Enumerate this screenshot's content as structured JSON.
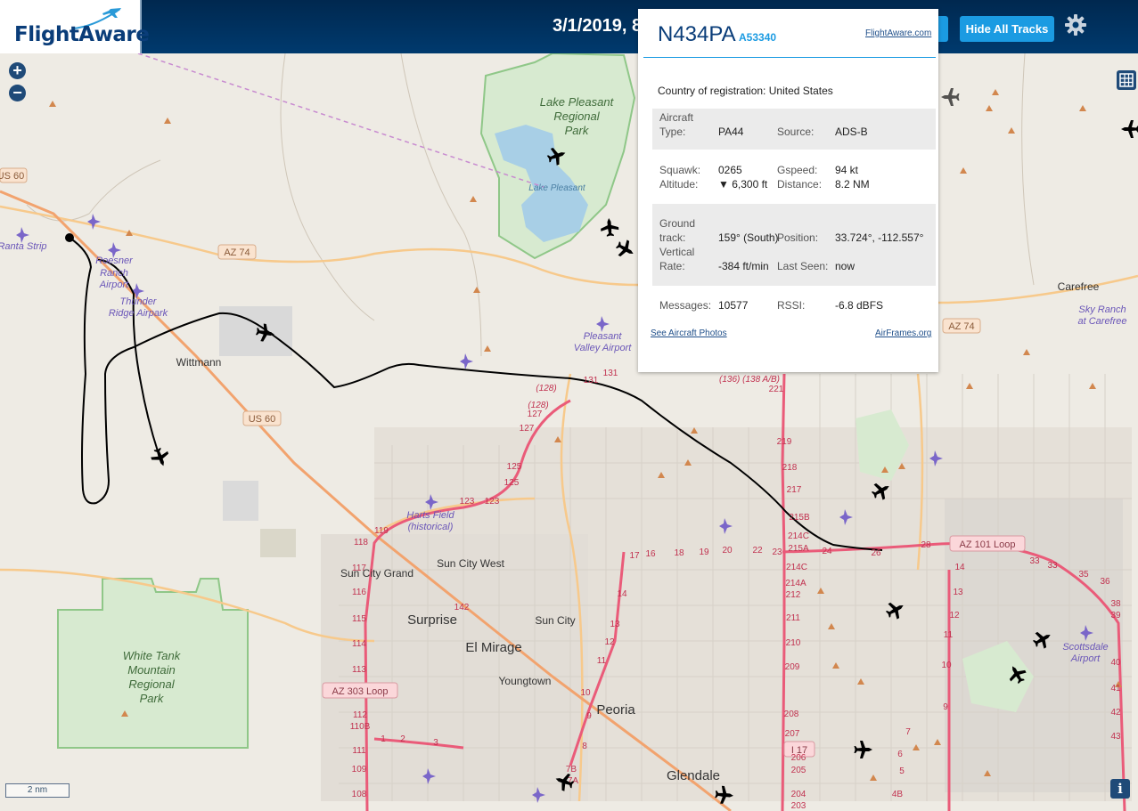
{
  "header": {
    "logo": "FlightAware",
    "datetime": "3/1/2019, 8",
    "hide_tracks_label": "Hide All Tracks",
    "settings_icon": "gear-icon",
    "accent": "#1b9be2",
    "bar_color": "#00284f"
  },
  "controls": {
    "zoom_in_icon": "plus-icon",
    "zoom_out_icon": "minus-icon",
    "layers_icon": "grid-icon",
    "scale_label": "2 nm",
    "info_icon": "info-icon"
  },
  "popup": {
    "ident": "N434PA",
    "hex": "A53340",
    "site_link": "FlightAware.com",
    "country_label": "Country of registration:",
    "country_value": "United States",
    "aircraft_type_label1": "Aircraft",
    "aircraft_type_label2": "Type:",
    "aircraft_type": "PA44",
    "source_label": "Source:",
    "source": "ADS-B",
    "squawk_label": "Squawk:",
    "squawk": "0265",
    "altitude_label": "Altitude:",
    "altitude": "▼ 6,300 ft",
    "gspeed_label": "Gspeed:",
    "gspeed": "94 kt",
    "distance_label": "Distance:",
    "distance": "8.2 NM",
    "ground_track_label1": "Ground",
    "ground_track_label2": "track:",
    "ground_track": "159° (South)",
    "position_label": "Position:",
    "position": "33.724°, -112.557°",
    "vrate_label1": "Vertical",
    "vrate_label2": "Rate:",
    "vrate": "-384 ft/min",
    "last_seen_label": "Last Seen:",
    "last_seen": "now",
    "messages_label": "Messages:",
    "messages": "10577",
    "rssi_label": "RSSI:",
    "rssi": "-6.8 dBFS",
    "photos_link": "See Aircraft Photos",
    "airframes_link": "AirFrames.org"
  },
  "map": {
    "labels": {
      "lake_park_1": "Lake Pleasant",
      "lake_park_2": "Regional",
      "lake_park_3": "Park",
      "lake": "Lake Pleasant",
      "us60_top": "US 60",
      "az74_left": "AZ 74",
      "az74_right": "AZ 74",
      "us60_mid": "US 60",
      "ranta": "Ranta Strip",
      "roesner_1": "Roesner",
      "roesner_2": "Ranch",
      "roesner_3": "Airport",
      "thunder_1": "Thunder",
      "thunder_2": "Ridge Airpark",
      "wittmann": "Wittmann",
      "pleasant_valley_1": "Pleasant",
      "pleasant_valley_2": "Valley Airport",
      "carefree": "Carefree",
      "sky_ranch_1": "Sky Ranch",
      "sky_ranch_2": "at Carefree",
      "harts_1": "Harts Field",
      "harts_2": "(historical)",
      "sun_city_grand": "Sun City Grand",
      "sun_city_west": "Sun City West",
      "surprise": "Surprise",
      "sun_city": "Sun City",
      "el_mirage": "El Mirage",
      "youngtown": "Youngtown",
      "peoria": "Peoria",
      "glendale": "Glendale",
      "white_tank_1": "White Tank",
      "white_tank_2": "Mountain",
      "white_tank_3": "Regional",
      "white_tank_4": "Park",
      "az101": "AZ 101 Loop",
      "az303": "AZ 303 Loop",
      "i17": "I 17",
      "scottsdale_1": "Scottsdale",
      "scottsdale_2": "Airport",
      "exits_138": "(136)  (138 A/B)",
      "r221": "221",
      "r219": "219",
      "r218": "218",
      "r217": "217",
      "r215b": "215B",
      "r214c": "214C",
      "r215a": "215A",
      "r214c2": "214C",
      "r214a": "214A",
      "r212": "212",
      "r211": "211",
      "r210": "210",
      "r209": "209",
      "r208": "208",
      "r207": "207",
      "r206": "206",
      "r205": "205",
      "r204": "204",
      "r203": "203",
      "r131a": "131",
      "r131b": "131",
      "r128a": "(128)",
      "r128b": "(128)",
      "r127a": "127",
      "r127b": "127",
      "r125a": "125",
      "r125b": "125",
      "r123a": "123",
      "r123b": "123",
      "r119": "119",
      "r118": "118",
      "r117": "117",
      "r116": "116",
      "r115": "115",
      "r114": "114",
      "r113": "113",
      "r112": "112",
      "r110b": "110B",
      "r111": "111",
      "r109": "109",
      "r108": "108",
      "r142": "142",
      "r17": "17",
      "r16": "16",
      "r18": "18",
      "r19": "19",
      "r20": "20",
      "r22": "22",
      "r23": "23",
      "r24": "24",
      "r26": "26",
      "r28": "28",
      "r14a": "14",
      "r13": "13",
      "r12": "12",
      "r11": "11",
      "r10a": "10",
      "r14b": "14",
      "r13b": "13",
      "r12b": "12",
      "r11b": "11",
      "r10b": "10",
      "r9a": "9",
      "r9b": "9",
      "r8": "8",
      "r7b": "7B",
      "r7a": "7A",
      "r1": "1",
      "r2": "2",
      "r3": "3",
      "r33a": "33",
      "r33b": "33",
      "r35": "35",
      "r36": "36",
      "r38": "38",
      "r39": "39",
      "r40": "40",
      "r41": "41",
      "r42": "42",
      "r43": "43",
      "r7": "7",
      "r6": "6",
      "r5": "5",
      "r4b": "4B",
      "r14c": "14",
      "r13c": "13",
      "r12c": "12",
      "r10c": "10",
      "r11c": "11"
    },
    "aircraft_icon": "airplane-icon",
    "airport_icon": "airport-icon",
    "peak_icon": "peak-icon",
    "colors": {
      "land": "#eeebe4",
      "park": "#cde7c4",
      "water": "#a8cfe6",
      "highway": "#ea5b79",
      "arterial": "#f7c98b",
      "track": "#000000"
    }
  }
}
